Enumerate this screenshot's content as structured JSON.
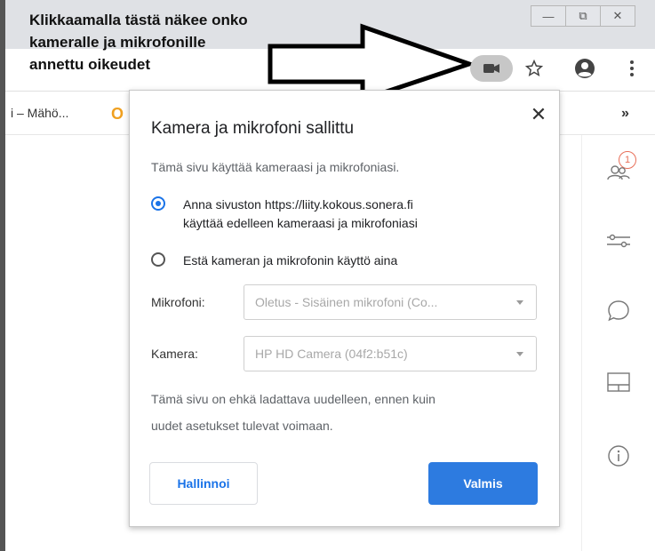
{
  "window": {
    "minimize_glyph": "—",
    "restore_glyph": "⧉",
    "close_glyph": "✕"
  },
  "annotation": {
    "lines": [
      "Klikkaamalla tästä näkee onko",
      "kameralle ja mikrofonille",
      "annettu oikeudet"
    ]
  },
  "toolbar": {
    "icons": [
      "camera-icon",
      "star-icon",
      "account-icon",
      "more-vert-icon"
    ]
  },
  "bookmarks": {
    "item_label": "i – Mähö...",
    "more_label": "»"
  },
  "dialog": {
    "title": "Kamera ja mikrofoni sallittu",
    "description": "Tämä sivu käyttää kameraasi ja mikrofoniasi.",
    "options": [
      {
        "line1": "Anna sivuston https://liity.kokous.sonera.fi",
        "line2": "käyttää edelleen kameraasi ja mikrofoniasi",
        "selected": true
      },
      {
        "line1": "Estä kameran ja mikrofonin käyttö aina",
        "selected": false
      }
    ],
    "microphone_label": "Mikrofoni:",
    "microphone_value": "Oletus - Sisäinen mikrofoni (Co...",
    "camera_label": "Kamera:",
    "camera_value": "HP HD Camera (04f2:b51c)",
    "note_line1": "Tämä sivu on ehkä ladattava uudelleen, ennen kuin",
    "note_line2": "uudet asetukset tulevat voimaan.",
    "manage_label": "Hallinnoi",
    "done_label": "Valmis",
    "close_glyph": "✕"
  },
  "right_panel": {
    "participants_badge": "1",
    "icons": [
      "participants-icon",
      "settings-sliders-icon",
      "chat-icon",
      "layout-icon",
      "info-icon"
    ]
  },
  "colors": {
    "accent": "#1a73e8",
    "done_button": "#2d7be0",
    "badge": "#e8705a"
  }
}
